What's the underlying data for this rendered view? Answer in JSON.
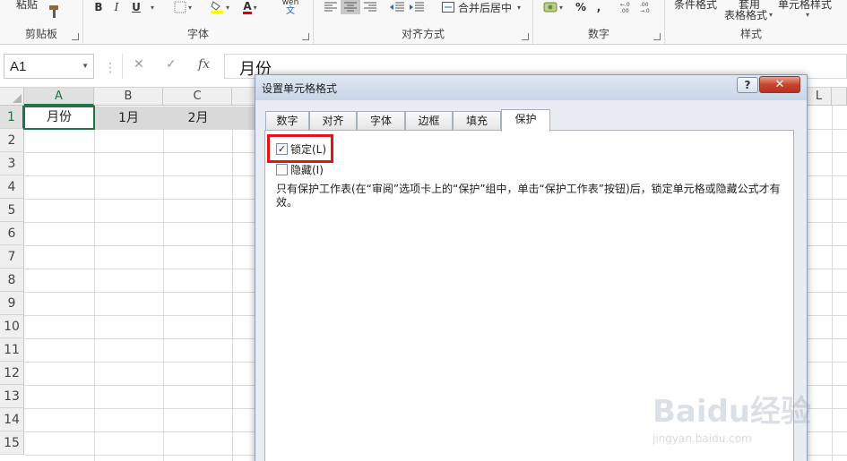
{
  "ribbon": {
    "clipboard": {
      "paste_label": "粘贴",
      "group_label": "剪贴板"
    },
    "font": {
      "bold": "B",
      "italic": "I",
      "underline": "U",
      "color_a": "A",
      "pinyin": "wén",
      "group_label": "字体"
    },
    "alignment": {
      "merge_label": "合并后居中",
      "group_label": "对齐方式"
    },
    "number": {
      "percent": "%",
      "comma": ",",
      "group_label": "数字"
    },
    "styles": {
      "conditional_label": "条件格式",
      "table_top": "套用",
      "table_label": "表格格式",
      "cell_style_label": "单元格样式",
      "group_label": "样式"
    }
  },
  "formula_bar": {
    "name_box": "A1",
    "cancel": "✕",
    "enter": "✓",
    "fx": "fx",
    "content": "月份"
  },
  "sheet": {
    "columns": [
      "A",
      "B",
      "C",
      "L"
    ],
    "rows": [
      "1",
      "2",
      "3",
      "4",
      "5",
      "6",
      "7",
      "8",
      "9",
      "10",
      "11",
      "12",
      "13",
      "14",
      "15"
    ],
    "cells": {
      "A1": "月份",
      "B1": "1月",
      "C1": "2月"
    }
  },
  "dialog": {
    "title": "设置单元格格式",
    "help": "?",
    "close": "✕",
    "tabs": [
      "数字",
      "对齐",
      "字体",
      "边框",
      "填充",
      "保护"
    ],
    "active_tab": "保护",
    "locked_label": "锁定(L)",
    "locked_checked": true,
    "hidden_label": "隐藏(I)",
    "hidden_checked": false,
    "description": "只有保护工作表(在“审阅”选项卡上的“保护”组中，单击“保护工作表”按钮)后，锁定单元格或隐藏公式才有效。"
  },
  "watermark": {
    "logo": "Baidu经验",
    "url": "jingyan.baidu.com"
  }
}
